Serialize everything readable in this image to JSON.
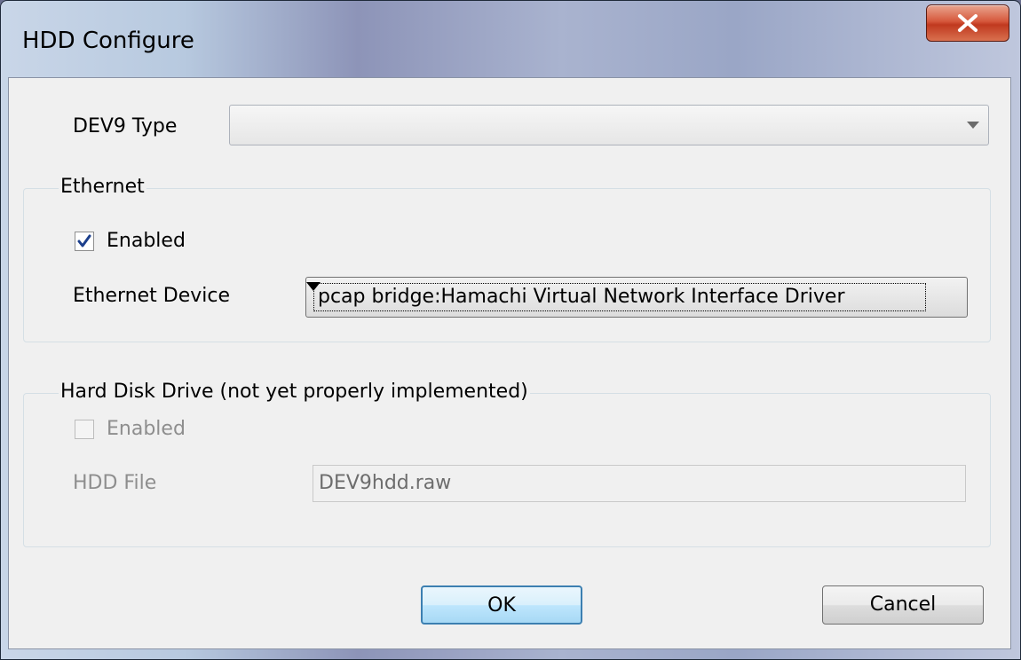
{
  "window": {
    "title": "HDD Configure"
  },
  "dev9_type": {
    "label": "DEV9 Type",
    "value": ""
  },
  "ethernet": {
    "group_label": "Ethernet",
    "enabled_label": "Enabled",
    "enabled_checked": true,
    "device_label": "Ethernet Device",
    "device_value": "pcap bridge:Hamachi Virtual Network Interface Driver"
  },
  "hdd": {
    "group_label": "Hard Disk Drive (not yet properly implemented)",
    "enabled_label": "Enabled",
    "enabled_checked": false,
    "file_label": "HDD File",
    "file_value": "DEV9hdd.raw"
  },
  "buttons": {
    "ok": "OK",
    "cancel": "Cancel"
  }
}
